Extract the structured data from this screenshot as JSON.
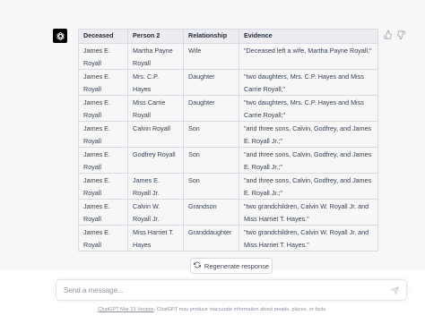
{
  "table": {
    "headers": [
      "Deceased",
      "Person 2",
      "Relationship",
      "Evidence"
    ],
    "rows": [
      [
        "James E. Royall",
        "Martha Payne Royall",
        "Wife",
        "\"Deceased left a wife, Martha Payne Royall;\""
      ],
      [
        "James E. Royall",
        "Mrs. C.P. Hayes",
        "Daughter",
        "\"two daughters, Mrs. C.P. Hayes and Miss Carrie Royall;\""
      ],
      [
        "James E. Royall",
        "Miss Carrie Royall",
        "Daughter",
        "\"two daughters, Mrs. C.P. Hayes and Miss Carrie Royall;\""
      ],
      [
        "James E. Royall",
        "Calvin Royall",
        "Son",
        "\"and three sons, Calvin, Godfrey, and James E. Royall Jr.;\""
      ],
      [
        "James E. Royall",
        "Godfrey Royall",
        "Son",
        "\"and three sons, Calvin, Godfrey, and James E. Royall Jr.;\""
      ],
      [
        "James E. Royall",
        "James E. Royall Jr.",
        "Son",
        "\"and three sons, Calvin, Godfrey, and James E. Royall Jr.;\""
      ],
      [
        "James E. Royall",
        "Calvin W. Royall Jr.",
        "Grandson",
        "\"two grandchildren, Calvin W. Royall Jr. and Miss Harriet T. Hayes.\""
      ],
      [
        "James E. Royall",
        "Miss Harriet T. Hayes",
        "Granddaughter",
        "\"two grandchildren, Calvin W. Royall Jr. and Miss Harriet T. Hayes.\""
      ]
    ]
  },
  "regenerate_label": "Regenerate response",
  "input": {
    "placeholder": "Send a message..."
  },
  "footer": {
    "version_link": "ChatGPT Mar 23 Version",
    "disclaimer": ". ChatGPT may produce inaccurate information about people, places, or facts."
  },
  "icons": {
    "avatar": "openai-logo-icon",
    "like": "thumbs-up-icon",
    "dislike": "thumbs-down-icon",
    "regenerate": "refresh-icon",
    "send": "send-icon"
  },
  "colors": {
    "background": "#f7f7f8",
    "avatar": "#000000",
    "border": "#d9d9e3"
  }
}
